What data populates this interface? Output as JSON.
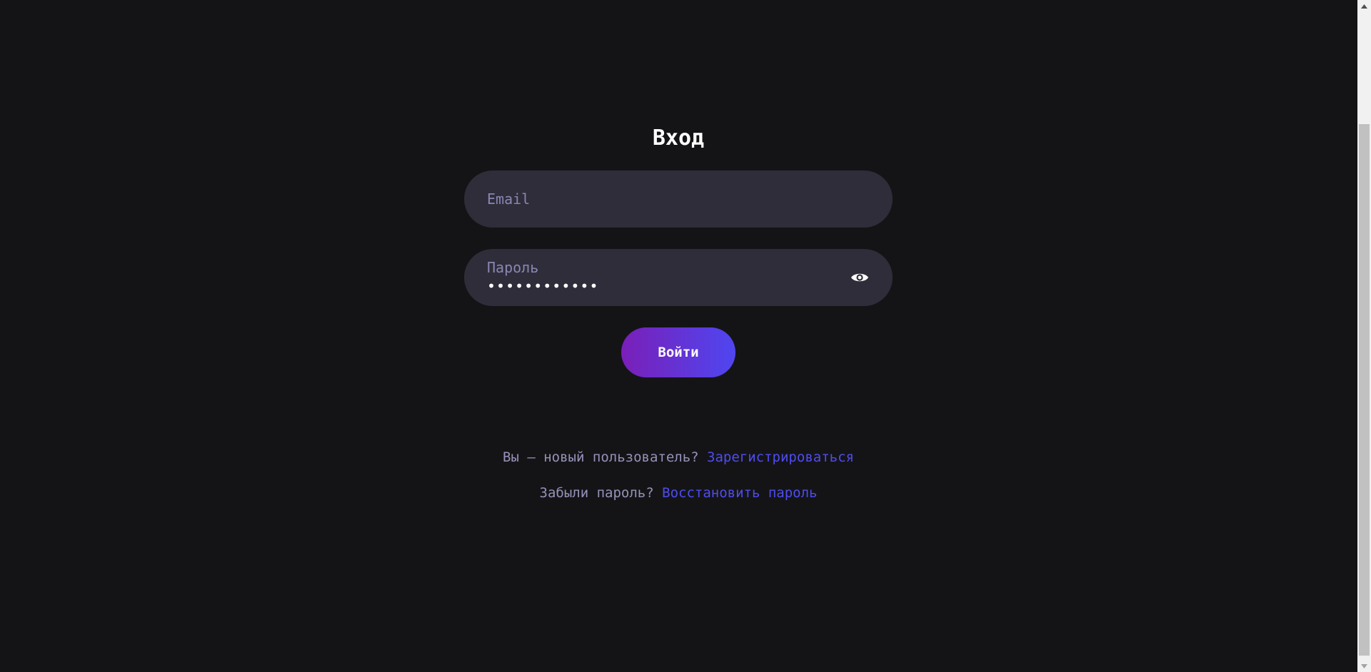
{
  "login": {
    "title": "Вход",
    "email": {
      "placeholder": "Email",
      "value": ""
    },
    "password": {
      "label": "Пароль",
      "masked_value": "••••••••••••",
      "toggle_icon": "eye-icon"
    },
    "submit_label": "Войти"
  },
  "links": {
    "register_prompt": "Вы — новый пользователь?",
    "register_link": "Зарегистрироваться",
    "forgot_prompt": "Забыли пароль?",
    "forgot_link": "Восстановить пароль"
  },
  "colors": {
    "background": "#141417",
    "field_background": "#2e2d39",
    "placeholder": "#8a86b3",
    "link": "#4f4cf0",
    "button_gradient_start": "#7a1fb8",
    "button_gradient_end": "#4f46f0"
  }
}
